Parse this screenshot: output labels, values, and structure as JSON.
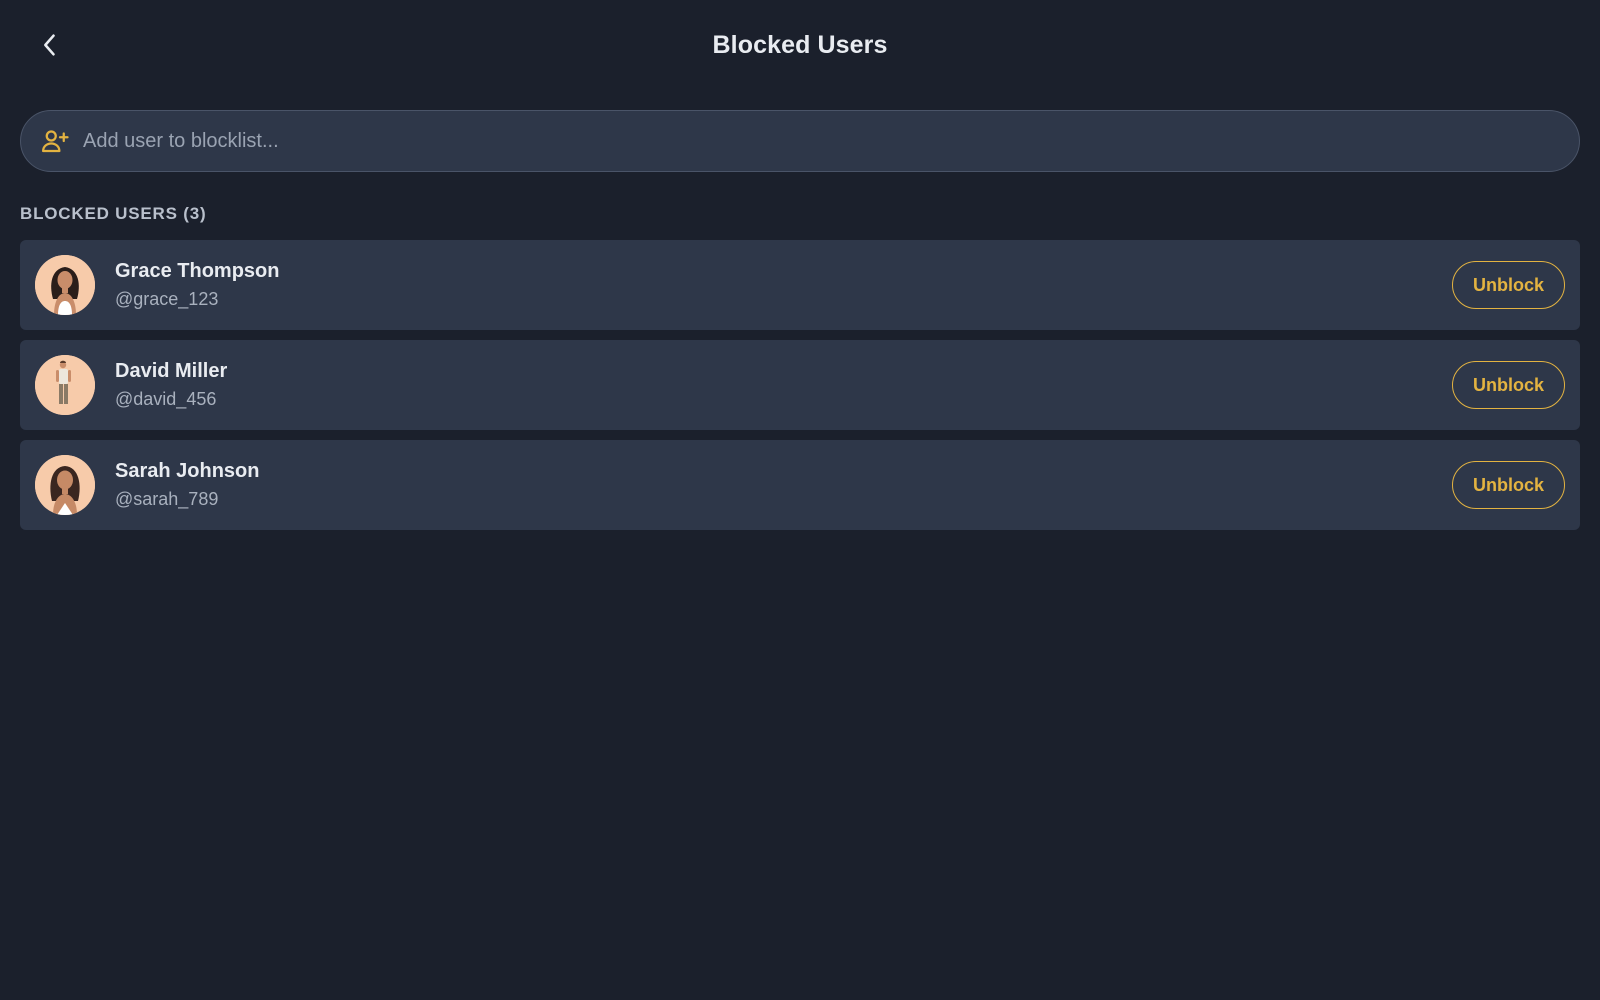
{
  "header": {
    "title": "Blocked Users",
    "back_icon": "chevron-left-icon"
  },
  "search": {
    "placeholder": "Add user to blocklist...",
    "value": "",
    "icon": "user-plus-icon"
  },
  "section": {
    "label": "BLOCKED USERS (3)"
  },
  "users": [
    {
      "name": "Grace Thompson",
      "handle": "@grace_123",
      "action": "Unblock"
    },
    {
      "name": "David Miller",
      "handle": "@david_456",
      "action": "Unblock"
    },
    {
      "name": "Sarah Johnson",
      "handle": "@sarah_789",
      "action": "Unblock"
    }
  ],
  "colors": {
    "background": "#1b202c",
    "card": "#2e3749",
    "accent": "#e3b341",
    "text_primary": "#e9ecf1",
    "text_secondary": "#a9b1be"
  }
}
